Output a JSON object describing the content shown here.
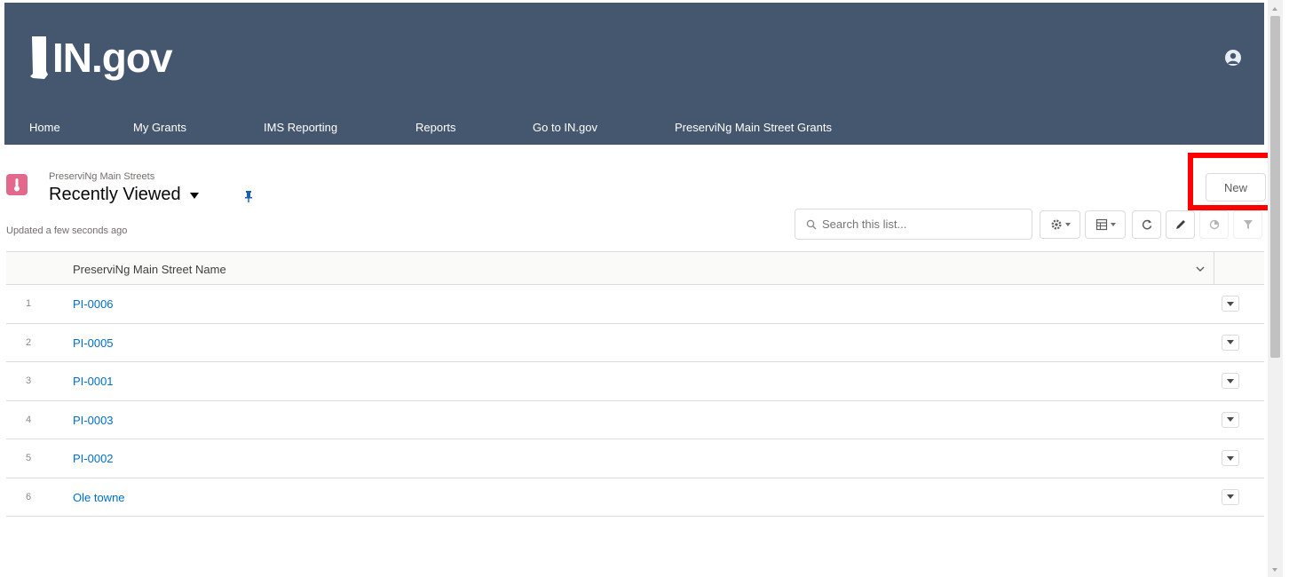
{
  "header": {
    "logo_text": "IN.gov",
    "nav": [
      "Home",
      "My Grants",
      "IMS Reporting",
      "Reports",
      "Go to IN.gov",
      "PreserviNg Main Street Grants"
    ]
  },
  "list_view": {
    "object_label": "PreserviNg Main Streets",
    "view_name": "Recently Viewed",
    "updated_text": "Updated a few seconds ago",
    "new_button": "New",
    "search_placeholder": "Search this list...",
    "column_header": "PreserviNg Main Street Name",
    "rows": [
      {
        "num": "1",
        "name": "PI-0006"
      },
      {
        "num": "2",
        "name": "PI-0005"
      },
      {
        "num": "3",
        "name": "PI-0001"
      },
      {
        "num": "4",
        "name": "PI-0003"
      },
      {
        "num": "5",
        "name": "PI-0002"
      },
      {
        "num": "6",
        "name": "Ole towne"
      }
    ]
  },
  "colors": {
    "header_bg": "#45566f",
    "link": "#006dcc",
    "object_icon": "#e2688c",
    "highlight": "#ff0000"
  },
  "icons": [
    "indiana-state-logo-icon",
    "user-avatar-icon",
    "object-thermometer-icon",
    "pin-icon",
    "search-icon",
    "gear-icon",
    "table-display-icon",
    "refresh-icon",
    "edit-pencil-icon",
    "chart-icon",
    "filter-icon",
    "chevron-down-icon"
  ]
}
